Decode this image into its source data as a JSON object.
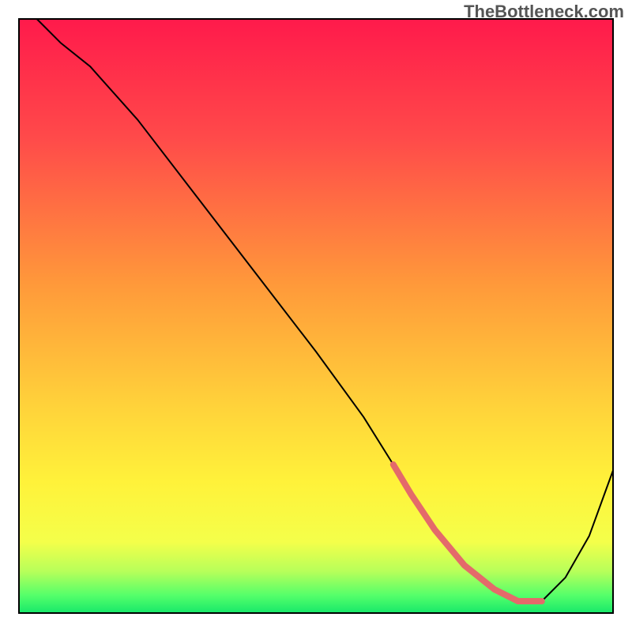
{
  "watermark": "TheBottleneck.com",
  "chart_data": {
    "type": "line",
    "title": "",
    "xlabel": "",
    "ylabel": "",
    "xlim": [
      0,
      100
    ],
    "ylim": [
      0,
      100
    ],
    "gradient_stops": [
      {
        "offset": 0,
        "color": "#ff1a4b"
      },
      {
        "offset": 20,
        "color": "#ff4a4a"
      },
      {
        "offset": 45,
        "color": "#ff9a3a"
      },
      {
        "offset": 65,
        "color": "#ffd23a"
      },
      {
        "offset": 78,
        "color": "#fff23a"
      },
      {
        "offset": 88,
        "color": "#f4ff4a"
      },
      {
        "offset": 93,
        "color": "#b7ff5a"
      },
      {
        "offset": 97,
        "color": "#55ff6a"
      },
      {
        "offset": 100,
        "color": "#17e86a"
      }
    ],
    "series": [
      {
        "name": "bottleneck-curve",
        "color": "#000000",
        "stroke_width": 2,
        "x": [
          3,
          7,
          12,
          20,
          30,
          40,
          50,
          58,
          63,
          66,
          70,
          75,
          80,
          84,
          88,
          92,
          96,
          100
        ],
        "values": [
          100,
          96,
          92,
          83,
          70,
          57,
          44,
          33,
          25,
          20,
          14,
          8,
          4,
          2,
          2,
          6,
          13,
          24
        ]
      },
      {
        "name": "optimal-band-marker",
        "color": "#e46a6a",
        "stroke_width": 8,
        "x": [
          63,
          66,
          70,
          75,
          80,
          84,
          88
        ],
        "values": [
          25,
          20,
          14,
          8,
          4,
          2,
          2
        ]
      }
    ]
  }
}
